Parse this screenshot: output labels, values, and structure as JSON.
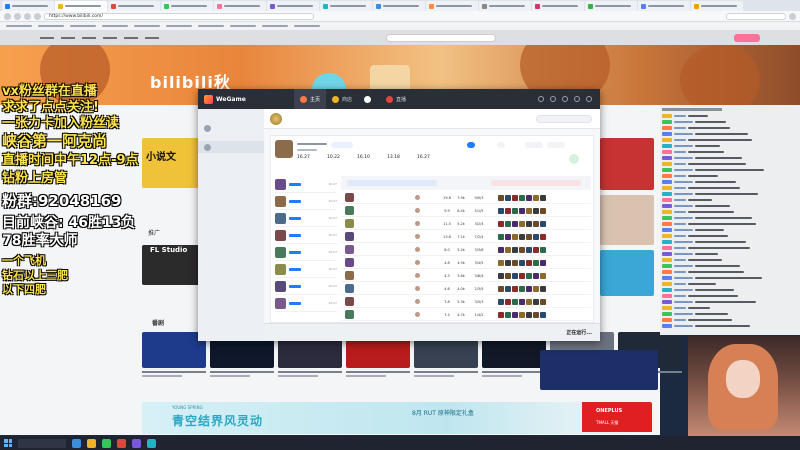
{
  "browser": {
    "url": "https://www.bilibili.com/"
  },
  "banner": {
    "logo": "bilibili秋"
  },
  "overlay": {
    "lines": [
      "vx粉丝群在直播",
      "求求了点点关注!",
      "一张力卡加入粉丝读",
      "峡谷第一阿克尚",
      "直播时间中午12点-9点",
      "钻粉上房管",
      "粉群:92048169",
      "目前峡谷: 46胜13负",
      "78胜率大师",
      "一个飞机",
      "钻石以上三肥",
      "以下四肥"
    ]
  },
  "page": {
    "novel_card": "小说文",
    "promo_label": "推广",
    "fl_title": "FL Studio",
    "section_title": "番剧",
    "ad_text": "青空结界",
    "ad_text2": "风灵动",
    "ad_sub": "YOUNG SPRING",
    "ad_mid": "8月 RUT 原神限定礼盒",
    "ad_red1": "ONEPLUS",
    "ad_red2": "TMALL 天猫"
  },
  "wegame": {
    "logo": "WeGame",
    "tabs": [
      {
        "label": "主页",
        "active": true
      },
      {
        "label": "商店",
        "active": false
      },
      {
        "label": "",
        "active": false
      },
      {
        "label": "直播",
        "active": false
      }
    ],
    "sidebar": [
      {
        "label": "",
        "active": false
      },
      {
        "label": "",
        "active": true
      }
    ],
    "sidebar_footer": "",
    "lol_tabs": [
      {
        "label": "",
        "active": false
      },
      {
        "label": "",
        "active": true
      },
      {
        "label": "",
        "active": false
      },
      {
        "label": "",
        "active": false
      },
      {
        "label": "",
        "active": false
      },
      {
        "label": "",
        "active": false
      }
    ],
    "lol_search_placeholder": "",
    "profile": {
      "pill_active": "",
      "pill_2": "",
      "stats": [
        {
          "k": "",
          "v": "16.27"
        },
        {
          "k": "",
          "v": "10.22"
        },
        {
          "k": "",
          "v": "16.10"
        },
        {
          "k": "",
          "v": "13.18"
        },
        {
          "k": "",
          "v": "16.27"
        }
      ]
    },
    "matches": [
      {
        "result": "",
        "time": "16:27",
        "color": "#3a6bd6"
      },
      {
        "result": "",
        "time": "16:27",
        "color": "#3a6bd6"
      },
      {
        "result": "",
        "time": "16:27",
        "color": "#3a6bd6"
      },
      {
        "result": "",
        "time": "16:27",
        "color": "#3a6bd6"
      },
      {
        "result": "",
        "time": "16:27",
        "color": "#3a6bd6"
      },
      {
        "result": "",
        "time": "16:27",
        "color": "#3a6bd6"
      },
      {
        "result": "",
        "time": "16:27",
        "color": "#3a6bd6"
      },
      {
        "result": "",
        "time": "16:27",
        "color": "#3a6bd6"
      }
    ],
    "detail_rows": [
      {
        "name": "",
        "v1": "19.8",
        "v2": "7.9k",
        "kda": "9/0/3"
      },
      {
        "name": "",
        "v1": "9.9",
        "v2": "6.4k",
        "kda": "5/1/5"
      },
      {
        "name": "",
        "v1": "11.0",
        "v2": "5.2k",
        "kda": "3/2/4"
      },
      {
        "name": "",
        "v1": "13.8",
        "v2": "7.1k",
        "kda": "7/2/4"
      },
      {
        "name": "",
        "v1": "8.0",
        "v2": "5.2k",
        "kda": "3/3/6"
      },
      {
        "name": "",
        "v1": "4.8",
        "v2": "4.9k",
        "kda": "3/4/5"
      },
      {
        "name": "",
        "v1": "4.3",
        "v2": "3.6k",
        "kda": "3/6/4"
      },
      {
        "name": "",
        "v1": "4.6",
        "v2": "4.0k",
        "kda": "2/3/5"
      },
      {
        "name": "",
        "v1": "7.8",
        "v2": "5.3k",
        "kda": "3/5/3"
      },
      {
        "name": "",
        "v1": "7.4",
        "v2": "4.7k",
        "kda": "1/4/2"
      }
    ],
    "footer_left": "",
    "footer_mid": "",
    "footer_right": "正在运行..."
  },
  "taskbar": {
    "clock": ""
  }
}
